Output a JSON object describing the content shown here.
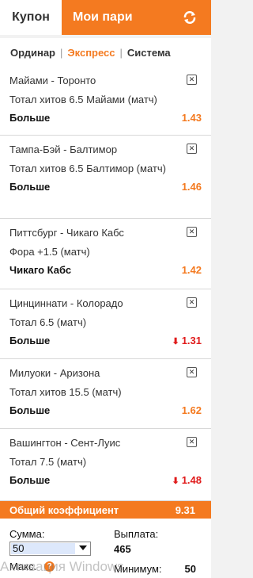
{
  "header": {
    "tab_coupon": "Купон",
    "tab_my_bets": "Мои пари"
  },
  "subtabs": {
    "single": "Ординар",
    "express": "Экспресс",
    "system": "Система"
  },
  "bets": [
    {
      "match": "Майами - Торонто",
      "market": "Тотал хитов 6.5 Майами (матч)",
      "choice": "Больше",
      "odds": "1.43",
      "dropped": false
    },
    {
      "match": "Тампа-Бэй - Балтимор",
      "market": "Тотал хитов 6.5 Балтимор (матч)",
      "choice": "Больше",
      "odds": "1.46",
      "dropped": false
    },
    {
      "match": "Питтсбург - Чикаго Кабс",
      "market": "Фора +1.5 (матч)",
      "choice": "Чикаго Кабс",
      "odds": "1.42",
      "dropped": false
    },
    {
      "match": "Цинциннати - Колорадо",
      "market": "Тотал 6.5 (матч)",
      "choice": "Больше",
      "odds": "1.31",
      "dropped": true
    },
    {
      "match": "Милуоки - Аризона",
      "market": "Тотал хитов 15.5 (матч)",
      "choice": "Больше",
      "odds": "1.62",
      "dropped": false
    },
    {
      "match": "Вашингтон - Сент-Луис",
      "market": "Тотал 7.5 (матч)",
      "choice": "Больше",
      "odds": "1.48",
      "dropped": true
    }
  ],
  "total": {
    "label": "Общий коэффициент",
    "value": "9.31"
  },
  "stake": {
    "sum_label": "Сумма:",
    "amount": "50",
    "payout_label": "Выплата:",
    "payout_value": "465",
    "max_label": "Макс.",
    "min_label": "Минимум:",
    "min_value": "50"
  },
  "watermark": "Активация Windows",
  "colors": {
    "accent": "#f47a20",
    "drop": "#e01b1b"
  }
}
